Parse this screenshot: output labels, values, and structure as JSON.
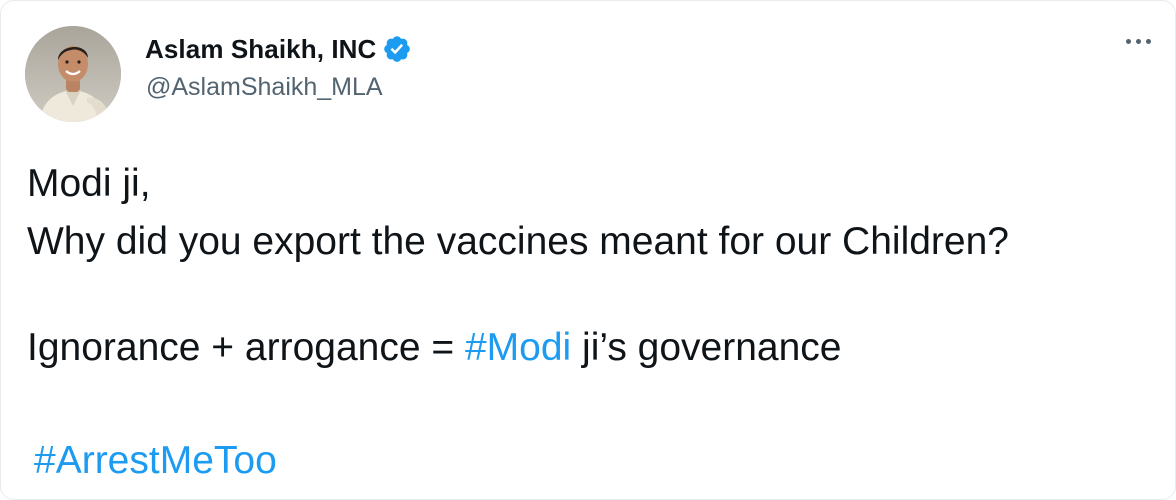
{
  "user": {
    "display_name": "Aslam Shaikh, INC",
    "handle": "@AslamShaikh_MLA",
    "verified": true,
    "avatar_icon": "profile-photo"
  },
  "menu": {
    "icon": "more-horizontal-icon"
  },
  "tweet": {
    "line1": "Modi ji,",
    "line2": "Why did you export the vaccines meant for our Children?",
    "line3_prefix": "Ignorance + arrogance = ",
    "line3_hashtag": "#Modi",
    "line3_suffix": " ji’s governance",
    "hashtag2": "#ArrestMeToo"
  },
  "colors": {
    "link": "#1d9bf0",
    "verified": "#1d9bf0",
    "text": "#0f1419",
    "secondary": "#536471"
  }
}
